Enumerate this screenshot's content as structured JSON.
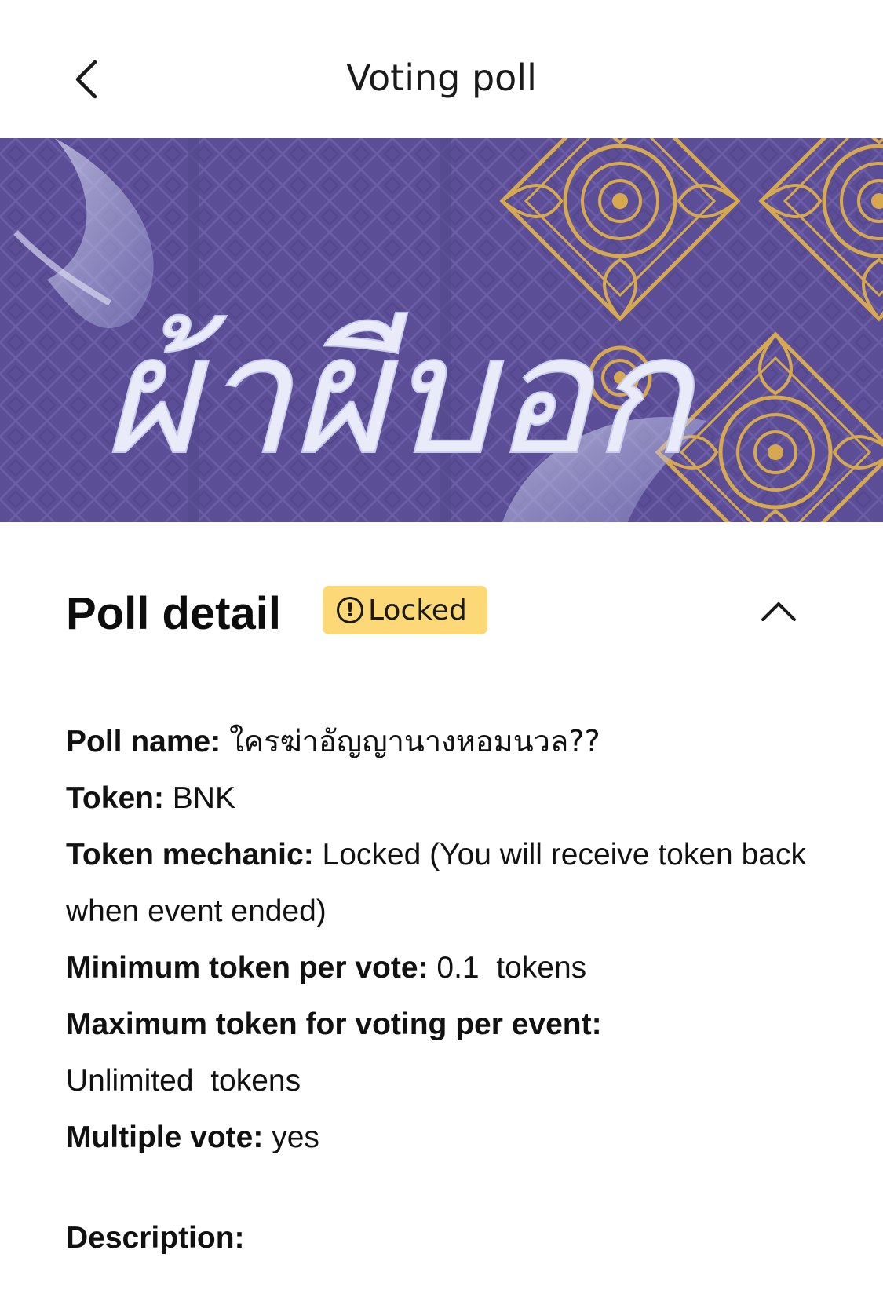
{
  "header": {
    "title": "Voting poll",
    "back_icon": "chevron-left-icon"
  },
  "banner": {
    "title_text": "ผ้าผีบอก",
    "colors": {
      "background": "#5b4e96",
      "ornament": "#d6a84f",
      "lettering": "#e9ecf8"
    }
  },
  "section": {
    "title": "Poll detail",
    "badge_label": "Locked",
    "badge_icon": "alert-circle-icon",
    "badge_color": "#fcd876",
    "collapse_icon": "chevron-up-icon"
  },
  "details": {
    "poll_name_label": "Poll name:",
    "poll_name_value": "ใครฆ่าอัญญานางหอมนวล??",
    "token_label": "Token:",
    "token_value": "BNK",
    "mechanic_label": "Token mechanic:",
    "mechanic_value": "Locked (You will receive token back when event ended)",
    "min_label": "Minimum token per vote:",
    "min_value": "0.1  tokens",
    "max_label": "Maximum token for voting per event:",
    "max_value": "Unlimited  tokens",
    "multiple_label": "Multiple vote:",
    "multiple_value": "yes"
  },
  "description": {
    "label": "Description:"
  }
}
